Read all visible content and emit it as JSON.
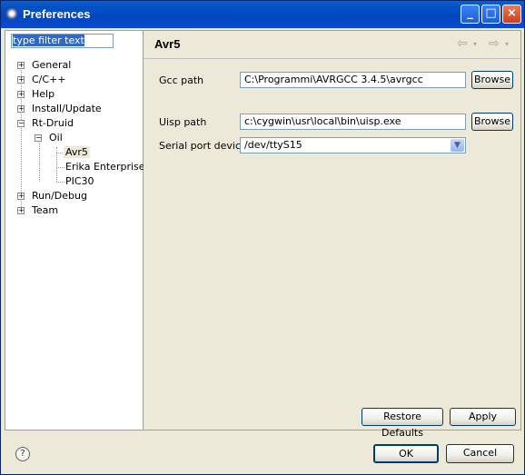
{
  "window": {
    "title": "Preferences"
  },
  "filter": {
    "value": "type filter text"
  },
  "tree": {
    "general": "General",
    "cpp": "C/C++",
    "help": "Help",
    "install_update": "Install/Update",
    "rt_druid": "Rt-Druid",
    "oil": "Oil",
    "avr5": "Avr5",
    "erika": "Erika Enterprise",
    "pic30": "PIC30",
    "run_debug": "Run/Debug",
    "team": "Team"
  },
  "page": {
    "title": "Avr5",
    "gcc_label": "Gcc path",
    "gcc_value": "C:\\Programmi\\AVRGCC 3.4.5\\avrgcc",
    "uisp_label": "Uisp path",
    "uisp_value": "c:\\cygwin\\usr\\local\\bin\\uisp.exe",
    "serial_label": "Serial port device",
    "serial_value": "/dev/ttyS15",
    "browse_label": "Browse"
  },
  "buttons": {
    "restore_defaults": "Restore Defaults",
    "apply": "Apply",
    "ok": "OK",
    "cancel": "Cancel"
  },
  "icons": {
    "help": "help-icon",
    "back": "back-arrow-icon",
    "forward": "forward-arrow-icon"
  }
}
